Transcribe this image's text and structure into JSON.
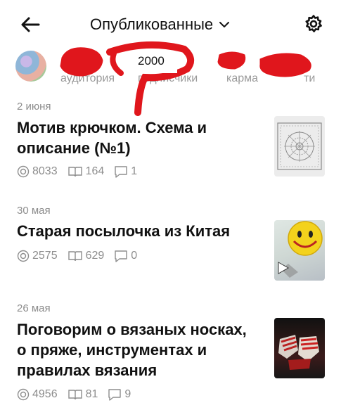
{
  "header": {
    "title": "Опубликованные"
  },
  "stats": {
    "audience_label": "аудитория",
    "subscribers_label": "подписчики",
    "karma_label": "карма",
    "views_label": "ти",
    "redacted_value": "2000"
  },
  "posts": [
    {
      "date": "2 июня",
      "title": "Мотив крючком. Схема и описание (№1)",
      "views": "8033",
      "reads": "164",
      "comments": "1"
    },
    {
      "date": "30 мая",
      "title": "Старая посылочка из Китая",
      "views": "2575",
      "reads": "629",
      "comments": "0"
    },
    {
      "date": "26 мая",
      "title": "Поговорим о вязаных носках, о пряже, инструментах и правилах вязания",
      "views": "4956",
      "reads": "81",
      "comments": "9"
    }
  ],
  "colors": {
    "scribble": "#e0161c",
    "muted_text": "#8d8d8d"
  },
  "icons": [
    "back-arrow-icon",
    "chevron-down-icon",
    "gear-icon",
    "eye-icon",
    "book-icon",
    "comment-icon",
    "play-icon"
  ]
}
